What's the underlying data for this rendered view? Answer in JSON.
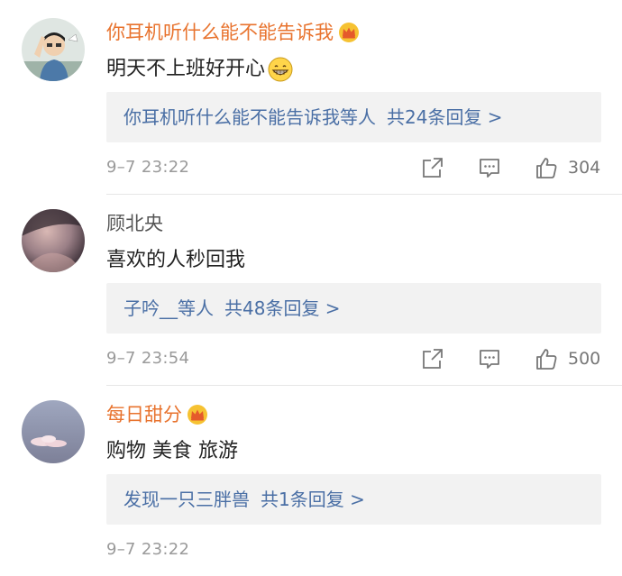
{
  "colors": {
    "vip_username": "#e8732e",
    "normal_username": "#555555",
    "reply_link": "#4a6fa5",
    "meta_text": "#9a9a9a",
    "reply_box_bg": "#f2f2f2"
  },
  "comments": [
    {
      "username": "你耳机听什么能不能告诉我",
      "vip": true,
      "text": "明天不上班好开心",
      "emoji": "grin-emoji",
      "reply_names": "你耳机听什么能不能告诉我等人",
      "reply_count": "共24条回复 >",
      "time": "9–7 23:22",
      "likes": "304"
    },
    {
      "username": "顾北央",
      "vip": false,
      "text": "喜欢的人秒回我",
      "reply_names": "子吟__等人",
      "reply_count": "共48条回复 >",
      "time": "9–7 23:54",
      "likes": "500"
    },
    {
      "username": "每日甜分",
      "vip": true,
      "text": "购物 美食 旅游",
      "reply_names": "发现一只三胖兽",
      "reply_count": "共1条回复 >",
      "time": "9–7 23:22"
    }
  ]
}
